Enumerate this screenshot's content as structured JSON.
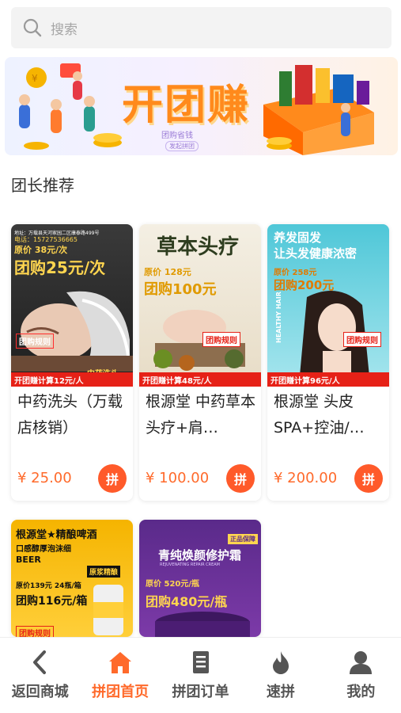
{
  "search": {
    "placeholder": "搜索"
  },
  "banner": {
    "title": "开团赚",
    "subtitle": "团购省钱",
    "badge": "发起拼团"
  },
  "section": {
    "title": "团长推荐"
  },
  "products": [
    {
      "name": "中药洗头（万载店核销）",
      "price": "¥ 25.00",
      "action": "拼",
      "image": {
        "address": "地址：万载县天河家园二区康泰路499号",
        "phone": "电话：15727536665",
        "orig": "原价 38元/次",
        "group": "团购25元/次",
        "rule": "团购规则",
        "footer": "开团赚计算12元/人",
        "tag": "中药洗头"
      }
    },
    {
      "name": "根源堂 中药草本头疗+肩…",
      "price": "¥ 100.00",
      "action": "拼",
      "image": {
        "headline": "草本头疗",
        "orig": "原价 128元",
        "group": "团购100元",
        "rule": "团购规则",
        "footer": "开团赚计算48元/人"
      }
    },
    {
      "name": "根源堂 头皮SPA+控油/…",
      "price": "¥ 200.00",
      "action": "拼",
      "image": {
        "headline1": "养发固发",
        "headline2": "让头发健康浓密",
        "orig": "原价 258元",
        "group": "团购200元",
        "side": "HEALTHY HAIR",
        "rule": "团购规则",
        "footer": "开团赚计算96元/人"
      }
    },
    {
      "name": "",
      "price": "",
      "action": "",
      "image": {
        "headline": "根源堂★精酿啤酒",
        "line2": "口感醇厚泡沫细",
        "beer": "BEER",
        "label": "原浆精酿",
        "orig": "原价139元 24瓶/箱",
        "group": "团购116元/箱",
        "rule": "团购规则"
      }
    },
    {
      "name": "",
      "price": "",
      "action": "",
      "image": {
        "badge": "正品保障",
        "headline": "青纯焕颜修护霜",
        "en": "REJUVENATING REPAIR CREAM",
        "orig": "原价 520元/瓶",
        "group": "团购480元/瓶"
      }
    }
  ],
  "tabbar": [
    {
      "label": "返回商城",
      "icon": "back-chevron-icon"
    },
    {
      "label": "拼团首页",
      "icon": "home-icon"
    },
    {
      "label": "拼团订单",
      "icon": "order-list-icon"
    },
    {
      "label": "速拼",
      "icon": "flame-icon"
    },
    {
      "label": "我的",
      "icon": "user-icon"
    }
  ],
  "colors": {
    "accent": "#ff6a2b",
    "pin_button": "#ff5a2a",
    "tab_inactive": "#555555"
  }
}
